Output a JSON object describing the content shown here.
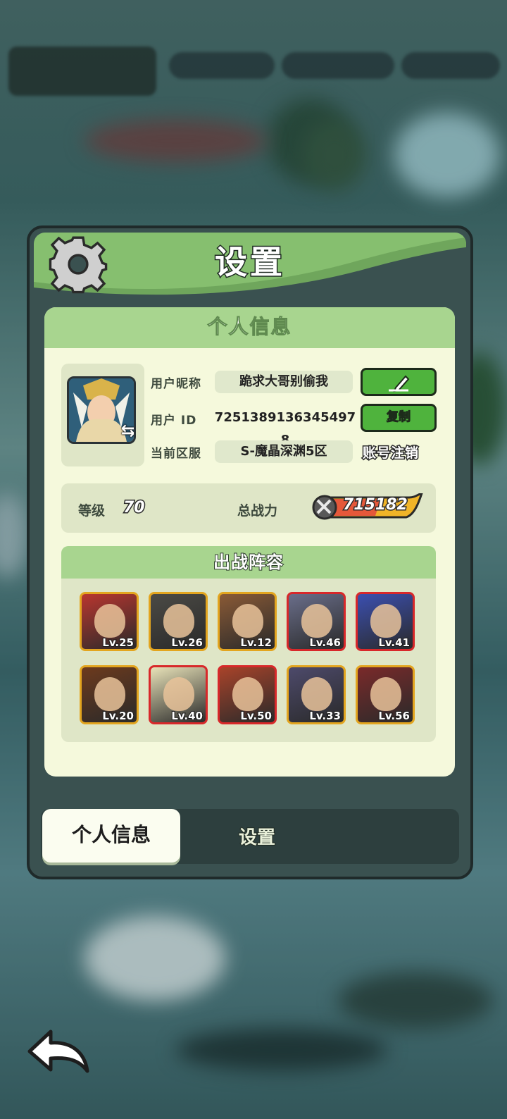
{
  "panel": {
    "title": "设置"
  },
  "profile_card": {
    "section_title": "个人信息",
    "nickname_label": "用户昵称",
    "nickname_value": "跪求大哥别偷我",
    "id_label": "用户 ID",
    "id_value": "7251389136345497 8",
    "server_label": "当前区服",
    "server_value": "S-魔晶深渊5区",
    "copy_label": "复制",
    "deregister_label": "账号注销"
  },
  "stats": {
    "level_label": "等级",
    "level_value": "70",
    "power_label": "总战力",
    "power_value": "715182"
  },
  "lineup": {
    "title": "出战阵容",
    "heroes": [
      {
        "level": "Lv.25",
        "frame": "gold",
        "color": "#b9362f"
      },
      {
        "level": "Lv.26",
        "frame": "gold",
        "color": "#4b4a45"
      },
      {
        "level": "Lv.12",
        "frame": "gold",
        "color": "#8a5a36"
      },
      {
        "level": "Lv.46",
        "frame": "red",
        "color": "#6a6e8a"
      },
      {
        "level": "Lv.41",
        "frame": "red",
        "color": "#3b4fb0"
      },
      {
        "level": "Lv.20",
        "frame": "gold",
        "color": "#6d3a1d"
      },
      {
        "level": "Lv.40",
        "frame": "red",
        "color": "#e8e2b8"
      },
      {
        "level": "Lv.50",
        "frame": "red",
        "color": "#a8432a"
      },
      {
        "level": "Lv.33",
        "frame": "gold",
        "color": "#4d4a6b"
      },
      {
        "level": "Lv.56",
        "frame": "gold",
        "color": "#7a2a2a"
      }
    ]
  },
  "tabs": {
    "active": "个人信息",
    "inactive": "设置"
  },
  "colors": {
    "panel_green": "#86bf6f",
    "button_green": "#4fb33d",
    "card_bg": "#f5f9dc"
  }
}
